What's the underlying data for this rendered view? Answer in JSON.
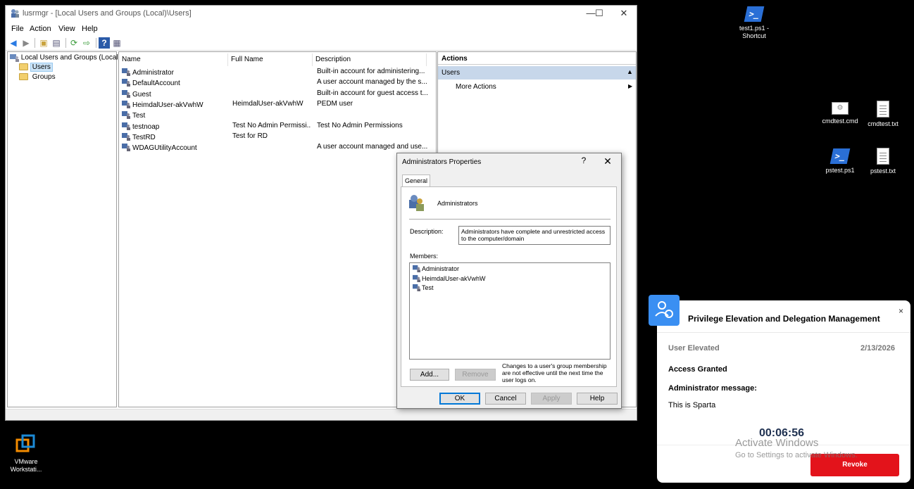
{
  "window": {
    "title": "lusrmgr - [Local Users and Groups (Local)\\Users]",
    "minimize": "—",
    "maximize": "☐",
    "close": "✕"
  },
  "menu": [
    "File",
    "Action",
    "View",
    "Help"
  ],
  "tree": {
    "root": "Local Users and Groups (Local)",
    "children": [
      "Users",
      "Groups"
    ]
  },
  "list": {
    "columns": [
      "Name",
      "Full Name",
      "Description"
    ],
    "rows": [
      {
        "name": "Administrator",
        "full_name": "",
        "description": "Built-in account for administering..."
      },
      {
        "name": "DefaultAccount",
        "full_name": "",
        "description": "A user account managed by the s..."
      },
      {
        "name": "Guest",
        "full_name": "",
        "description": "Built-in account for guest access t..."
      },
      {
        "name": "HeimdalUser-akVwhW",
        "full_name": "HeimdalUser-akVwhW",
        "description": "PEDM user"
      },
      {
        "name": "Test",
        "full_name": "",
        "description": ""
      },
      {
        "name": "testnoap",
        "full_name": "Test No Admin Permissi...",
        "description": "Test No Admin Permissions"
      },
      {
        "name": "TestRD",
        "full_name": "Test for RD",
        "description": ""
      },
      {
        "name": "WDAGUtilityAccount",
        "full_name": "",
        "description": "A user account managed and use..."
      }
    ]
  },
  "actions": {
    "header": "Actions",
    "section": "Users",
    "more": "More Actions"
  },
  "dialog": {
    "title": "Administrators Properties",
    "help": "?",
    "close": "✕",
    "tab": "General",
    "group_name": "Administrators",
    "description_label": "Description:",
    "description_value": "Administrators have complete and unrestricted access to the computer/domain",
    "members_label": "Members:",
    "members": [
      "Administrator",
      "HeimdalUser-akVwhW",
      "Test"
    ],
    "add": "Add...",
    "remove": "Remove",
    "note": "Changes to a user's group membership are not effective until the next time the user logs on.",
    "ok": "OK",
    "cancel": "Cancel",
    "apply": "Apply",
    "help_btn": "Help"
  },
  "desktop": {
    "icons": [
      {
        "label": "test1.ps1 - Shortcut",
        "icon": "powershell-icon"
      },
      {
        "label": "cmdtest.cmd",
        "icon": "cmd-file-icon"
      },
      {
        "label": "cmdtest.txt",
        "icon": "text-file-icon"
      },
      {
        "label": "pstest.ps1",
        "icon": "powershell-icon"
      },
      {
        "label": "pstest.txt",
        "icon": "text-file-icon"
      },
      {
        "label": "VMware Workstati...",
        "icon": "vmware-icon"
      }
    ]
  },
  "notification": {
    "title": "Privilege Elevation and Delegation Management",
    "close": "×",
    "status": "User Elevated",
    "date": "2/13/2026",
    "access": "Access Granted",
    "message_label": "Administrator message:",
    "message": "This is Sparta",
    "timer": "00:06:56",
    "revoke": "Revoke",
    "accent": "#3a8ff2",
    "revoke_color": "#e3131b"
  },
  "watermark": {
    "line1": "Activate Windows",
    "line2": "Go to Settings to activate Windows."
  }
}
